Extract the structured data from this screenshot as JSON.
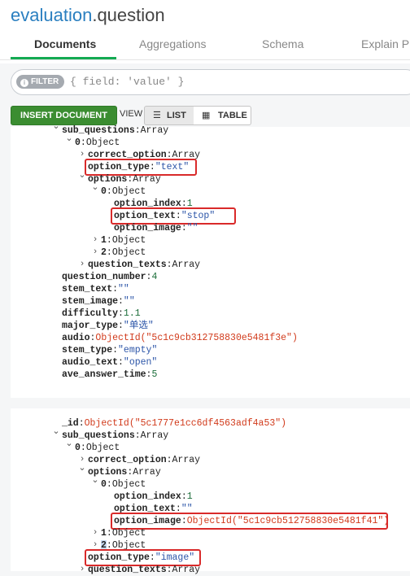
{
  "header": {
    "db": "evaluation",
    "sep": ".",
    "collection": "question",
    "tabs": [
      "Documents",
      "Aggregations",
      "Schema",
      "Explain P"
    ]
  },
  "filter": {
    "label": "FILTER",
    "placeholder": "{ field: 'value' }"
  },
  "toolbar": {
    "insert_label": "INSERT DOCUMENT",
    "view_label": "VIEW",
    "list_label": "LIST",
    "table_label": "TABLE"
  },
  "doc1": {
    "lines": [
      {
        "key": "sub_questions",
        "colon": ":",
        "val": "Array",
        "t": "c"
      },
      {
        "key": "0",
        "colon": ":",
        "val": "Object",
        "t": "c"
      },
      {
        "key": "correct_option",
        "colon": ":",
        "val": "Array",
        "t": "c"
      },
      {
        "key": "option_type",
        "colon": ":",
        "val": "\"text\"",
        "t": "s"
      },
      {
        "key": "options",
        "colon": ":",
        "val": "Array",
        "t": "c"
      },
      {
        "key": "0",
        "colon": ":",
        "val": "Object",
        "t": "c"
      },
      {
        "key": "option_index",
        "colon": ":",
        "val": "1",
        "t": "n"
      },
      {
        "key": "option_text",
        "colon": ":",
        "val": "\"stop\"",
        "t": "s"
      },
      {
        "key": "option_image",
        "colon": ":",
        "val": "\"\"",
        "t": "s"
      },
      {
        "key": "1",
        "colon": ":",
        "val": "Object",
        "t": "c"
      },
      {
        "key": "2",
        "colon": ":",
        "val": "Object",
        "t": "c"
      },
      {
        "key": "question_texts",
        "colon": ":",
        "val": "Array",
        "t": "c"
      },
      {
        "key": "question_number",
        "colon": ":",
        "val": "4",
        "t": "n"
      },
      {
        "key": "stem_text",
        "colon": ":",
        "val": "\"\"",
        "t": "s"
      },
      {
        "key": "stem_image",
        "colon": ":",
        "val": "\"\"",
        "t": "s"
      },
      {
        "key": "difficulty",
        "colon": ":",
        "val": "1.1",
        "t": "n"
      },
      {
        "key": "major_type",
        "colon": ":",
        "val": "\"单选\"",
        "t": "s"
      },
      {
        "key": "audio",
        "colon": ":",
        "val": "ObjectId(\"5c1c9cb312758830e5481f3e\")",
        "t": "o"
      },
      {
        "key": "stem_type",
        "colon": ":",
        "val": "\"empty\"",
        "t": "s"
      },
      {
        "key": "audio_text",
        "colon": ":",
        "val": "\"open\"",
        "t": "s"
      },
      {
        "key": "ave_answer_time",
        "colon": ":",
        "val": "5",
        "t": "n"
      }
    ]
  },
  "doc2": {
    "lines": [
      {
        "key": "_id",
        "colon": ":",
        "val": "ObjectId(\"5c1777e1cc6df4563adf4a53\")",
        "t": "o"
      },
      {
        "key": "sub_questions",
        "colon": ":",
        "val": "Array",
        "t": "c"
      },
      {
        "key": "0",
        "colon": ":",
        "val": "Object",
        "t": "c"
      },
      {
        "key": "correct_option",
        "colon": ":",
        "val": "Array",
        "t": "c"
      },
      {
        "key": "options",
        "colon": ":",
        "val": "Array",
        "t": "c"
      },
      {
        "key": "0",
        "colon": ":",
        "val": "Object",
        "t": "c"
      },
      {
        "key": "option_index",
        "colon": ":",
        "val": "1",
        "t": "n"
      },
      {
        "key": "option_text",
        "colon": ":",
        "val": "\"\"",
        "t": "s"
      },
      {
        "key": "option_image",
        "colon": ":",
        "val": "ObjectId(\"5c1c9cb512758830e5481f41\")",
        "t": "o"
      },
      {
        "key": "1",
        "colon": ":",
        "val": "Object",
        "t": "c"
      },
      {
        "key": "2",
        "colon": ":",
        "val": "Object",
        "t": "c"
      },
      {
        "key": "option_type",
        "colon": ":",
        "val": "\"image\"",
        "t": "s"
      },
      {
        "key": "question_texts",
        "colon": ":",
        "val": "Array",
        "t": "c"
      }
    ]
  },
  "colors": {
    "accent": "#13aa52",
    "highlight": "#d92a2a",
    "string": "#2c55a8",
    "number": "#1c6e3a",
    "objectid": "#d13a1b"
  },
  "icons": [
    "chevron-down-icon",
    "chevron-right-icon",
    "list-icon",
    "table-icon",
    "info-icon"
  ]
}
